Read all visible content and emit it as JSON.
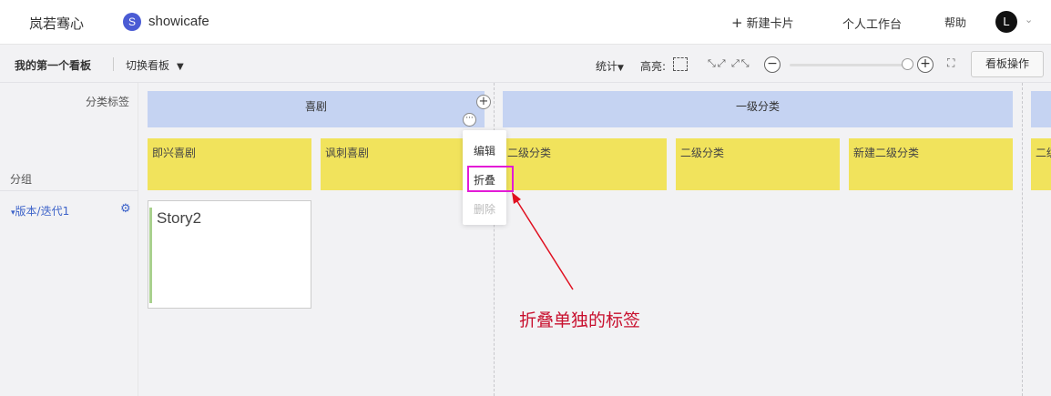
{
  "topbar": {
    "org_name": "岚若骞心",
    "project_icon_letter": "S",
    "project_name": "showicafe",
    "new_card_plus": "+",
    "new_card_label": "新建卡片",
    "workspace_label": "个人工作台",
    "help_label": "帮助",
    "avatar_letter": "L",
    "avatar_caret": "⌄"
  },
  "toolbar": {
    "board_title": "我的第一个看板",
    "switch_board_label": "切换看板",
    "switch_caret": "▼",
    "stats_label": "统计",
    "stats_caret": "▼",
    "highlight_label": "高亮:",
    "shrink_glyph": "⤡⤢",
    "expand_glyph": "⤢⤡",
    "zoom_out": "−",
    "zoom_in": "+",
    "zoom_level": 1.0,
    "fullscreen_glyph": "⛶",
    "board_ops_label": "看板操作"
  },
  "board": {
    "category_label": "分类标签",
    "group_label": "分组",
    "version_label": "版本/迭代1",
    "version_tri": "▾",
    "gear_glyph": "⚙",
    "level1": [
      {
        "label": "喜剧"
      },
      {
        "label": "一级分类"
      },
      {
        "label": ""
      }
    ],
    "level1_plus": "+",
    "level1_more": "···",
    "level2": [
      {
        "label": "即兴喜剧"
      },
      {
        "label": "讽刺喜剧"
      },
      {
        "label": "二级分类"
      },
      {
        "label": "二级分类"
      },
      {
        "label": "新建二级分类"
      },
      {
        "label": "二级"
      }
    ],
    "cards": [
      {
        "title": "Story2"
      }
    ]
  },
  "context_menu": {
    "items": [
      {
        "label": "编辑"
      },
      {
        "label": "折叠"
      },
      {
        "label": "删除"
      }
    ]
  },
  "annotation": {
    "text": "折叠单独的标签"
  },
  "colors": {
    "level1_bg": "#c5d3f2",
    "level2_bg": "#f1e35c",
    "highlight_border": "#e31bd6",
    "annotation_red": "#c8102e",
    "link_blue": "#3d63c9"
  }
}
